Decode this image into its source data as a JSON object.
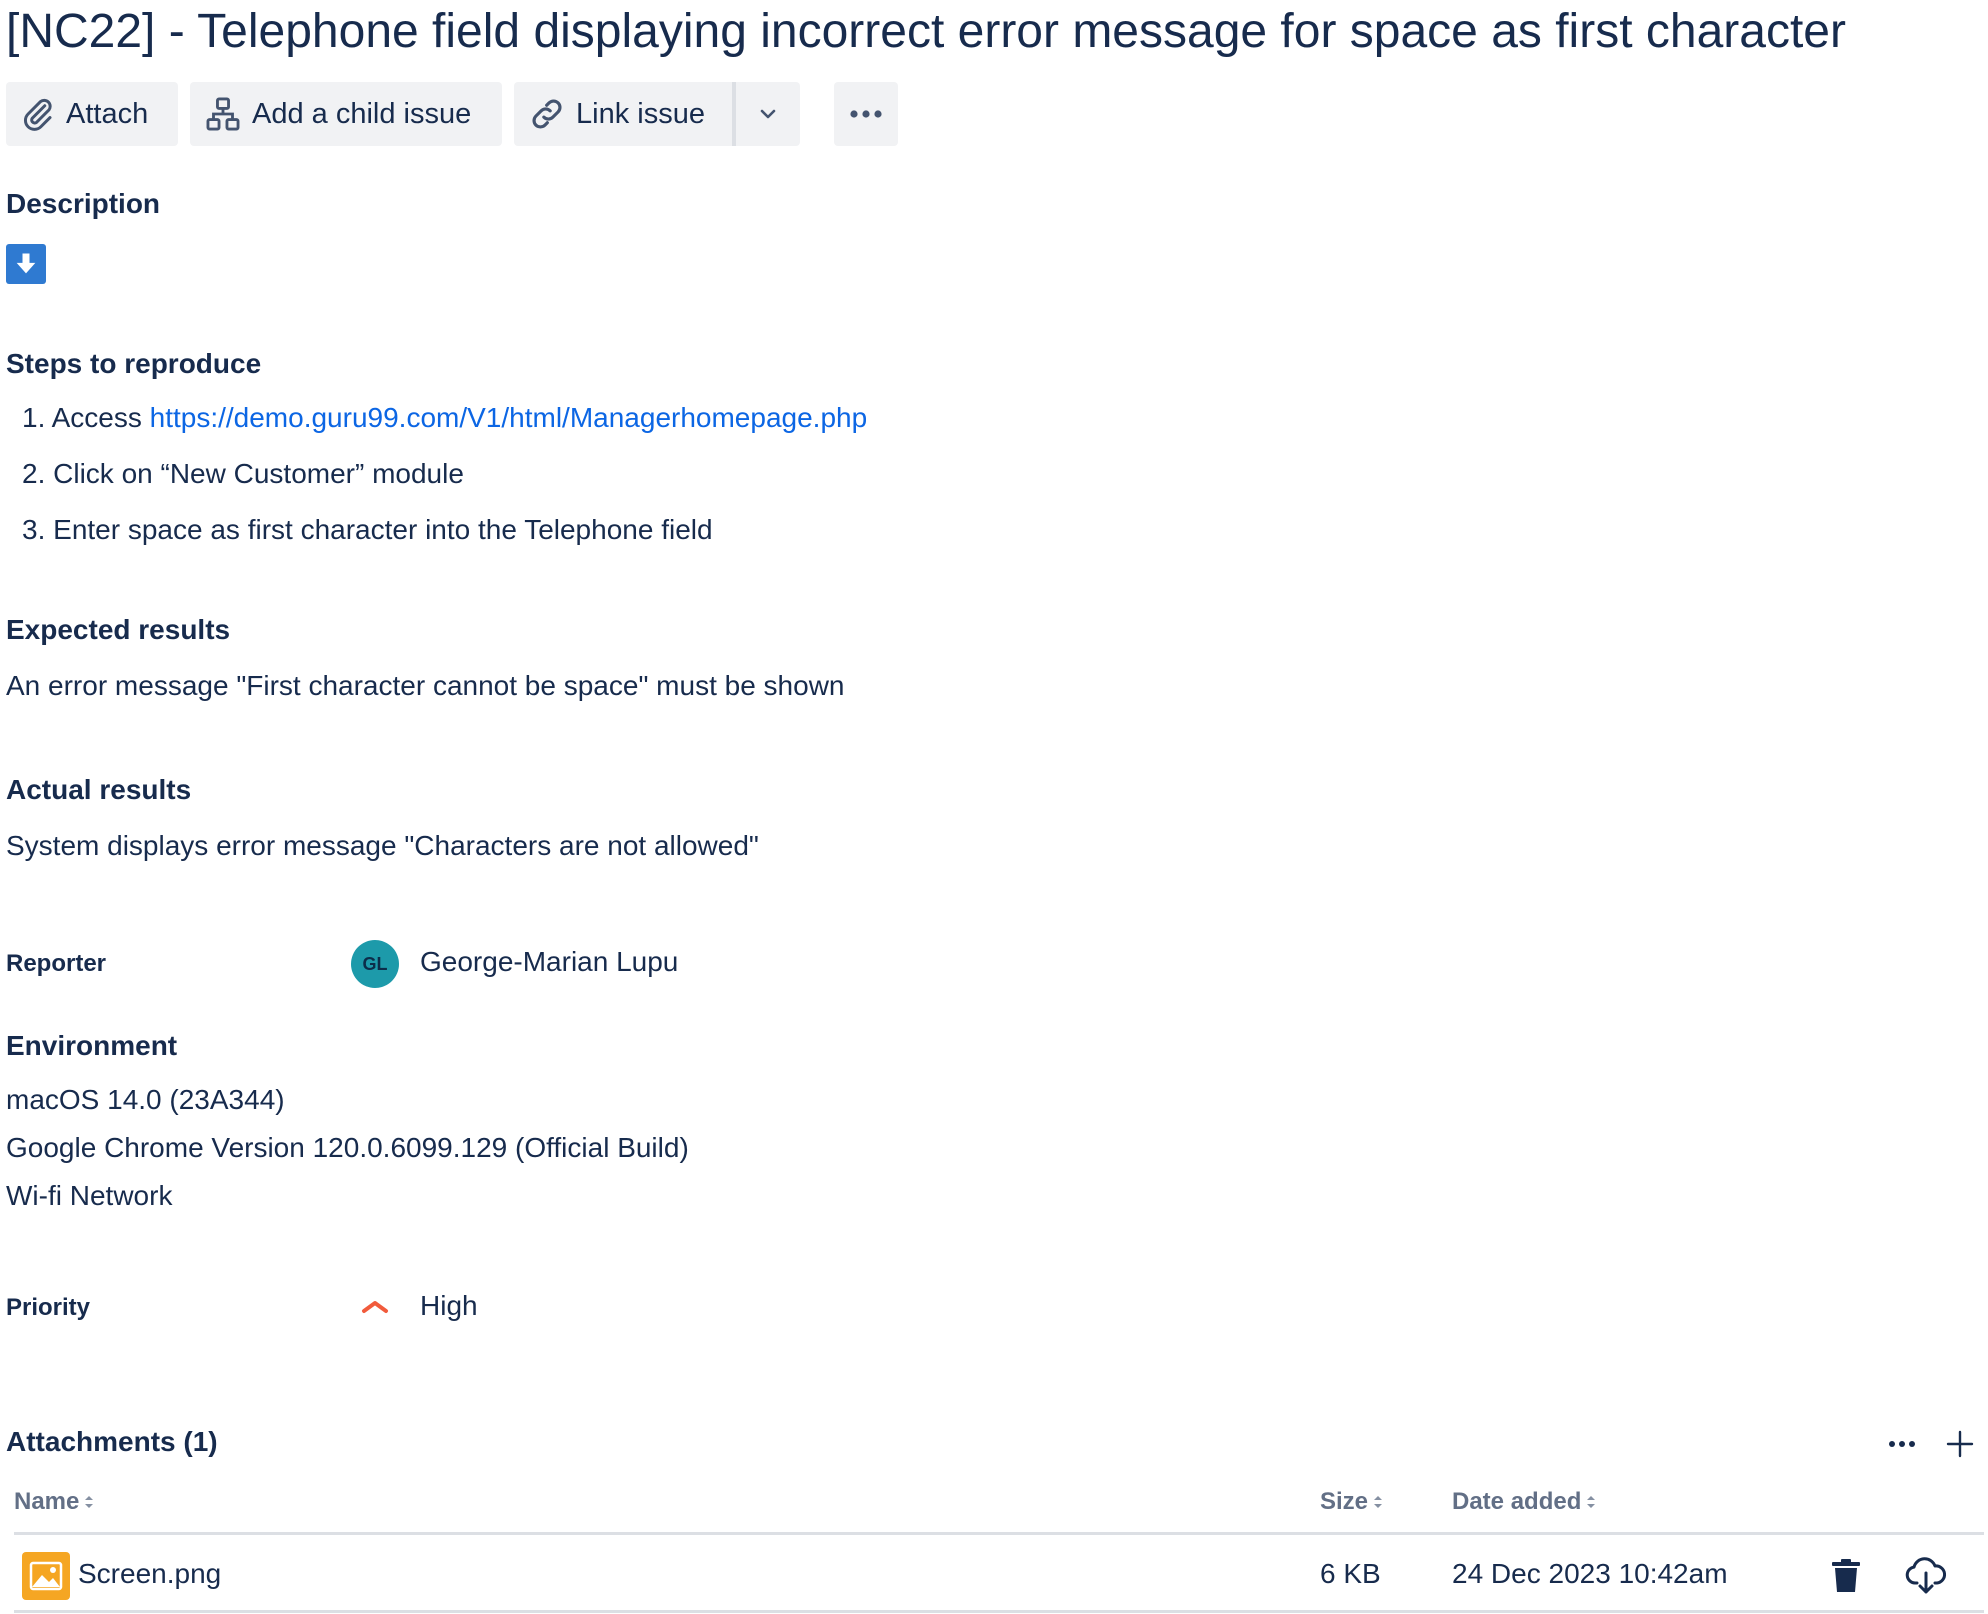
{
  "issue": {
    "title": "[NC22] - Telephone field displaying incorrect error message for space as first character"
  },
  "toolbar": {
    "attach_label": "Attach",
    "child_issue_label": "Add a child issue",
    "link_issue_label": "Link issue"
  },
  "description": {
    "heading": "Description",
    "steps_heading": "Steps to reproduce",
    "steps": [
      {
        "num": "1.",
        "prefix": "Access ",
        "link": "https://demo.guru99.com/V1/html/Managerhomepage.php"
      },
      {
        "num": "2.",
        "text": "Click on “New Customer” module"
      },
      {
        "num": "3.",
        "text": "Enter space as first character into the Telephone field"
      }
    ],
    "expected_heading": "Expected results",
    "expected_text": "An error message \"First character cannot be space\" must be shown",
    "actual_heading": "Actual results",
    "actual_text": "System displays error message \"Characters are not allowed\""
  },
  "reporter": {
    "label": "Reporter",
    "initials": "GL",
    "name": "George-Marian Lupu",
    "avatar_color": "#1d9aaa"
  },
  "environment": {
    "heading": "Environment",
    "lines": [
      "macOS 14.0 (23A344)",
      "Google Chrome Version 120.0.6099.129 (Official Build)",
      "Wi-fi Network"
    ]
  },
  "priority": {
    "label": "Priority",
    "value": "High",
    "color": "#f15b3c"
  },
  "attachments": {
    "heading": "Attachments (1)",
    "columns": {
      "name": "Name",
      "size": "Size",
      "date": "Date added"
    },
    "rows": [
      {
        "name": "Screen.png",
        "size": "6 KB",
        "date": "24 Dec 2023 10:42am",
        "icon": "image-file-icon"
      }
    ]
  },
  "colors": {
    "text": "#172b4d",
    "link": "#0c66e4",
    "button_bg": "#f1f2f4",
    "download_icon_bg": "#2f7ad1",
    "file_icon_bg": "#f5a623"
  }
}
